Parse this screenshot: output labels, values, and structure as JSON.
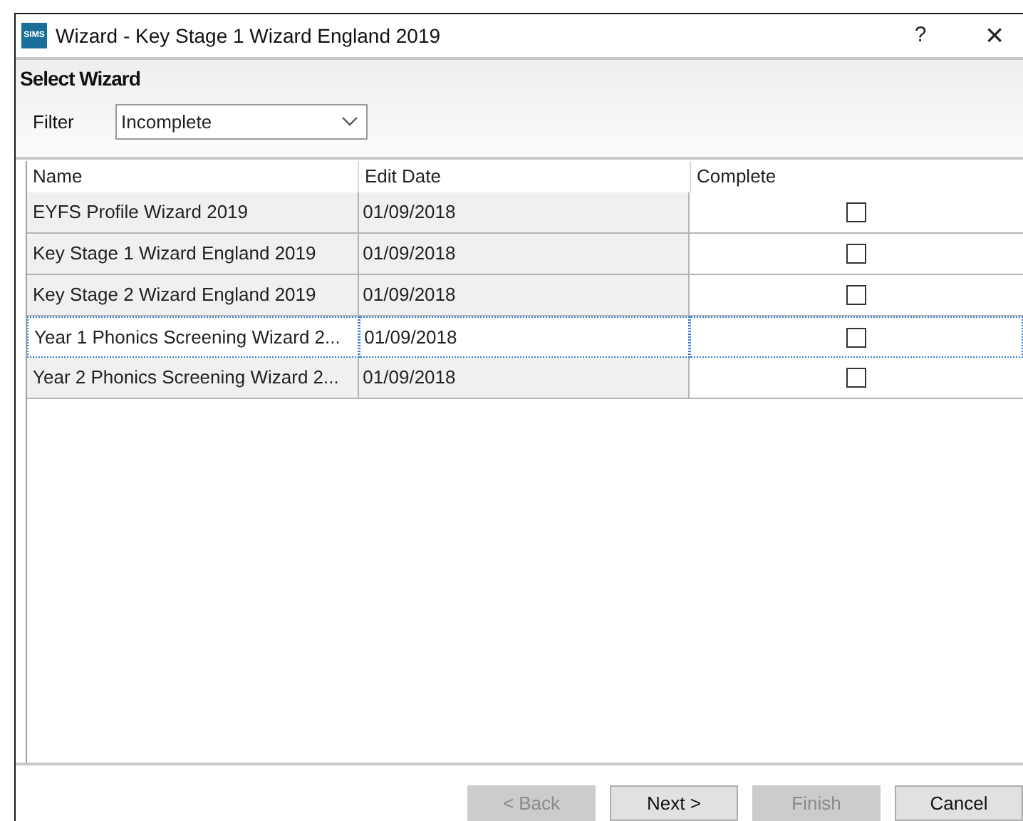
{
  "window": {
    "logo": "SIMS",
    "title": "Wizard - Key Stage 1 Wizard England 2019",
    "help": "?",
    "close": "×"
  },
  "header": {
    "title": "Select Wizard"
  },
  "filter": {
    "label": "Filter",
    "value": "Incomplete"
  },
  "table": {
    "columns": [
      "Name",
      "Edit Date",
      "Complete"
    ],
    "rows": [
      {
        "name": "EYFS Profile Wizard 2019",
        "edit_date": "01/09/2018",
        "complete": false,
        "selected": false
      },
      {
        "name": "Key Stage 1 Wizard England 2019",
        "edit_date": "01/09/2018",
        "complete": false,
        "selected": false
      },
      {
        "name": "Key Stage 2 Wizard England 2019",
        "edit_date": "01/09/2018",
        "complete": false,
        "selected": false
      },
      {
        "name": "Year 1 Phonics Screening Wizard 2...",
        "edit_date": "01/09/2018",
        "complete": false,
        "selected": true
      },
      {
        "name": "Year 2 Phonics Screening Wizard 2...",
        "edit_date": "01/09/2018",
        "complete": false,
        "selected": false
      }
    ]
  },
  "buttons": [
    {
      "label": "< Back",
      "disabled": true
    },
    {
      "label": "Next >",
      "disabled": false
    },
    {
      "label": "Finish",
      "disabled": true
    },
    {
      "label": "Cancel",
      "disabled": false
    }
  ]
}
